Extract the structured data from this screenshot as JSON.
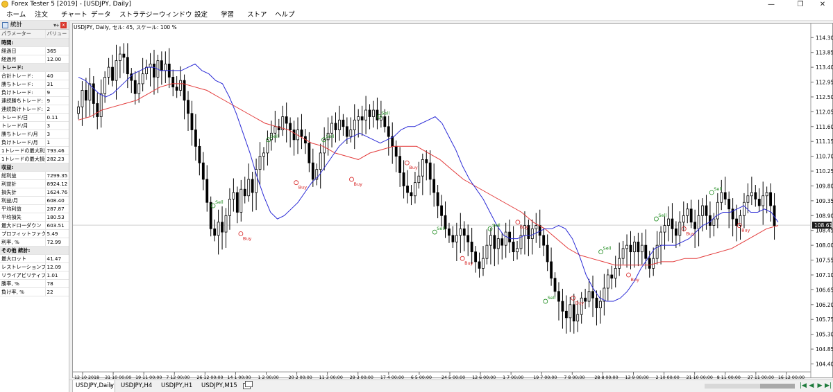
{
  "titlebar": {
    "title": "Forex Tester 5  [2019] - [USDJPY, Daily]",
    "minimize": "—",
    "restore": "❐",
    "close": "✕"
  },
  "menu": [
    "ホーム",
    "注文",
    "チャート",
    "データ",
    "ストラテジー",
    "ウィンドウ",
    "設定",
    "学習",
    "ストア",
    "ヘルプ"
  ],
  "stats": {
    "title": "統計",
    "pin": "▾ᚐ",
    "close": "x",
    "header": {
      "param": "パラメーター",
      "value": "バリュー"
    },
    "rows": [
      {
        "section": "時間:"
      },
      {
        "label": "経過日",
        "value": "365"
      },
      {
        "label": "経過月",
        "value": "12.00"
      },
      {
        "section": "トレード:"
      },
      {
        "label": "合計トレード:",
        "value": "40"
      },
      {
        "label": "勝ちトレード:",
        "value": "31"
      },
      {
        "label": "負けトレード:",
        "value": "9"
      },
      {
        "label": "連続勝ちトレード:",
        "value": "9"
      },
      {
        "label": "連続負けトレード:",
        "value": "2"
      },
      {
        "label": "トレード/日",
        "value": "0.11"
      },
      {
        "label": "トレード/月",
        "value": "3"
      },
      {
        "label": "勝ちトレード/月",
        "value": "3"
      },
      {
        "label": "負けトレード/月",
        "value": "1"
      },
      {
        "label": "1トレードの最大利益",
        "value": "793.46"
      },
      {
        "label": "1トレードの最大損失",
        "value": "282.23"
      },
      {
        "section": "収益:"
      },
      {
        "label": "総利益",
        "value": "7299.35"
      },
      {
        "label": "利益計",
        "value": "8924.12"
      },
      {
        "label": "損失計",
        "value": "1624.76"
      },
      {
        "label": "利益/月",
        "value": "608.40"
      },
      {
        "label": "平均利益",
        "value": "287.87"
      },
      {
        "label": "平均損失",
        "value": "180.53"
      },
      {
        "label": "最大ドローダウン",
        "value": "603.51"
      },
      {
        "label": "プロフィットファクター",
        "value": "5.49"
      },
      {
        "label": "利率, %",
        "value": "72.99"
      },
      {
        "section": "その他 統計:"
      },
      {
        "label": "最大ロット",
        "value": "41.47"
      },
      {
        "label": "レストレーションファクタ",
        "value": "12.09"
      },
      {
        "label": "リライアビリティファクター",
        "value": "1.01"
      },
      {
        "label": "勝率, %",
        "value": "78"
      },
      {
        "label": "負け率, %",
        "value": "22"
      }
    ]
  },
  "chart": {
    "info": "USDJPY, Daily, セル: 45, スケール: 100 %",
    "current_price": "108.61",
    "colors": {
      "ma_fast": "#2b2bd6",
      "ma_slow": "#e33a3a",
      "buy": "#d62020",
      "sell": "#1b8a1b",
      "candle": "#000000"
    },
    "buy_label": "Buy",
    "sell_label": "Sell"
  },
  "chart_data": {
    "type": "line",
    "symbol": "USDJPY",
    "timeframe": "Daily",
    "ylim": [
      104.2,
      114.6
    ],
    "yticks": [
      "114.30",
      "113.85",
      "113.40",
      "112.95",
      "112.50",
      "112.05",
      "111.60",
      "111.15",
      "110.70",
      "110.25",
      "109.80",
      "109.35",
      "108.90",
      "108.45",
      "108.00",
      "107.55",
      "107.10",
      "106.65",
      "106.20",
      "105.75",
      "105.30",
      "104.85",
      "104.40"
    ],
    "xticks": [
      "12 10 2018",
      "31 10 00:00",
      "19 11 00:00",
      "7 12 00:00",
      "26 12 00:00",
      "14 1 00:00",
      "1 2 00:00",
      "20 2 00:00",
      "11 3 00:00",
      "29 3 00:00",
      "17 4 00:00",
      "6 5 00:00",
      "24 5 00:00",
      "12 6 00:00",
      "1 7 00:00",
      "19 7 00:00",
      "7 8 00:00",
      "28 8 00:00",
      "13 9 00:00",
      "2 10 00:00",
      "21 10 00:00",
      "8 11 00:00",
      "27 11 00:00",
      "16 12 00:00"
    ],
    "close_path": [
      112.2,
      112.7,
      112.4,
      112.9,
      112.3,
      111.9,
      112.6,
      113.1,
      113.4,
      113.0,
      113.6,
      113.8,
      113.7,
      113.2,
      113.0,
      112.6,
      112.9,
      113.2,
      113.4,
      113.5,
      113.1,
      113.6,
      113.3,
      113.5,
      113.1,
      112.8,
      112.7,
      113.0,
      112.4,
      112.0,
      111.5,
      111.0,
      110.5,
      110.0,
      109.3,
      108.5,
      108.3,
      108.7,
      108.4,
      108.9,
      109.4,
      109.6,
      109.0,
      109.7,
      109.5,
      110.0,
      109.6,
      110.3,
      110.7,
      110.8,
      111.2,
      111.4,
      111.6,
      111.5,
      111.9,
      111.7,
      111.5,
      111.2,
      111.5,
      111.3,
      111.1,
      110.5,
      110.0,
      110.3,
      110.8,
      111.2,
      111.4,
      111.7,
      111.5,
      111.8,
      111.6,
      111.3,
      111.5,
      111.8,
      111.9,
      111.8,
      112.1,
      111.9,
      112.1,
      111.8,
      111.9,
      111.6,
      111.3,
      111.0,
      110.7,
      110.2,
      109.8,
      109.6,
      109.5,
      109.9,
      110.1,
      110.6,
      110.5,
      110.0,
      109.6,
      109.2,
      108.9,
      108.5,
      108.3,
      108.1,
      108.3,
      108.5,
      108.3,
      108.1,
      107.8,
      107.5,
      107.3,
      107.6,
      108.0,
      108.3,
      107.9,
      108.2,
      108.0,
      108.4,
      108.1,
      107.8,
      107.9,
      108.3,
      108.6,
      108.2,
      108.5,
      108.6,
      108.3,
      108.0,
      107.5,
      107.0,
      106.6,
      106.3,
      106.0,
      105.8,
      106.2,
      105.7,
      105.9,
      106.4,
      106.3,
      106.6,
      106.4,
      106.1,
      106.3,
      106.7,
      107.1,
      107.0,
      107.3,
      107.6,
      107.9,
      108.0,
      107.8,
      108.1,
      107.8,
      108.0,
      107.6,
      107.3,
      107.6,
      108.0,
      108.4,
      108.6,
      108.8,
      108.5,
      108.3,
      108.7,
      108.9,
      109.1,
      108.7,
      108.5,
      108.9,
      109.2,
      108.9,
      108.6,
      108.8,
      109.3,
      109.6,
      109.4,
      109.1,
      108.8,
      108.6,
      108.9,
      109.3,
      109.5,
      109.6,
      109.4,
      109.2,
      109.5,
      109.6,
      109.2,
      108.6
    ],
    "ma_fast": [
      113.1,
      113.0,
      112.8,
      112.6,
      112.5,
      112.6,
      112.8,
      113.0,
      113.2,
      113.3,
      113.4,
      113.4,
      113.3,
      113.3,
      113.3,
      113.3,
      113.4,
      113.5,
      113.3,
      113.2,
      113.0,
      112.9,
      112.5,
      112.0,
      111.4,
      110.8,
      110.1,
      109.5,
      109.0,
      108.8,
      108.9,
      109.1,
      109.3,
      109.6,
      109.9,
      110.1,
      110.4,
      110.7,
      111.0,
      111.2,
      111.3,
      111.4,
      111.3,
      111.2,
      111.1,
      111.2,
      111.3,
      111.5,
      111.6,
      111.6,
      111.7,
      111.8,
      111.9,
      111.7,
      111.3,
      110.9,
      110.4,
      110.0,
      109.7,
      109.4,
      109.0,
      108.6,
      108.3,
      108.2,
      108.2,
      108.3,
      108.3,
      108.4,
      108.5,
      108.5,
      108.6,
      108.5,
      108.2,
      107.7,
      107.1,
      106.7,
      106.4,
      106.3,
      106.3,
      106.4,
      106.6,
      106.9,
      107.3,
      107.6,
      107.9,
      108.0,
      108.0,
      108.0,
      108.1,
      108.2,
      108.4,
      108.6,
      108.7,
      108.9,
      109.0,
      109.0,
      109.1,
      109.2,
      109.0,
      109.0,
      109.1,
      109.0,
      108.7
    ],
    "ma_slow": [
      111.8,
      111.9,
      112.1,
      112.2,
      112.3,
      112.4,
      112.6,
      112.8,
      112.9,
      112.9,
      112.8,
      112.7,
      112.5,
      112.3,
      112.1,
      111.9,
      111.7,
      111.6,
      111.5,
      111.3,
      111.1,
      111.0,
      110.8,
      110.7,
      110.6,
      110.8,
      110.9,
      111.0,
      111.0,
      111.0,
      110.8,
      110.6,
      110.3,
      110.0,
      109.8,
      109.6,
      109.4,
      109.2,
      109.0,
      108.7,
      108.5,
      108.2,
      107.9,
      107.7,
      107.6,
      107.5,
      107.4,
      107.4,
      107.4,
      107.4,
      107.5,
      107.5,
      107.6,
      107.6,
      107.7,
      107.8,
      107.9,
      108.1,
      108.3,
      108.5,
      108.6
    ],
    "series": [
      {
        "name": "USDJPY",
        "values": "close_path"
      }
    ],
    "signals": [
      {
        "type": "Sell",
        "price": 109.2
      },
      {
        "type": "Buy",
        "price": 108.35
      },
      {
        "type": "Sell",
        "price": 111.2
      },
      {
        "type": "Buy",
        "price": 109.9
      },
      {
        "type": "Sell",
        "price": 111.2
      },
      {
        "type": "Buy",
        "price": 110.0
      },
      {
        "type": "Sell",
        "price": 111.9
      },
      {
        "type": "Buy",
        "price": 110.5
      },
      {
        "type": "Sell",
        "price": 108.4
      },
      {
        "type": "Buy",
        "price": 107.6
      },
      {
        "type": "Sell",
        "price": 108.5
      },
      {
        "type": "Buy",
        "price": 108.7
      },
      {
        "type": "Sell",
        "price": 106.3
      },
      {
        "type": "Buy",
        "price": 106.4
      },
      {
        "type": "Sell",
        "price": 107.8
      },
      {
        "type": "Buy",
        "price": 107.1
      },
      {
        "type": "Sell",
        "price": 108.8
      },
      {
        "type": "Buy",
        "price": 108.5
      },
      {
        "type": "Sell",
        "price": 109.6
      },
      {
        "type": "Buy",
        "price": 108.6
      }
    ]
  },
  "tabs": [
    {
      "label": "USDJPY,Daily",
      "active": true
    },
    {
      "label": "USDJPY,H4"
    },
    {
      "label": "USDJPY,H1"
    },
    {
      "label": "USDJPY,M15"
    }
  ],
  "tab_close": "×",
  "nav": [
    "|◀",
    "◀",
    "▶",
    "▶|",
    "▶▶"
  ]
}
